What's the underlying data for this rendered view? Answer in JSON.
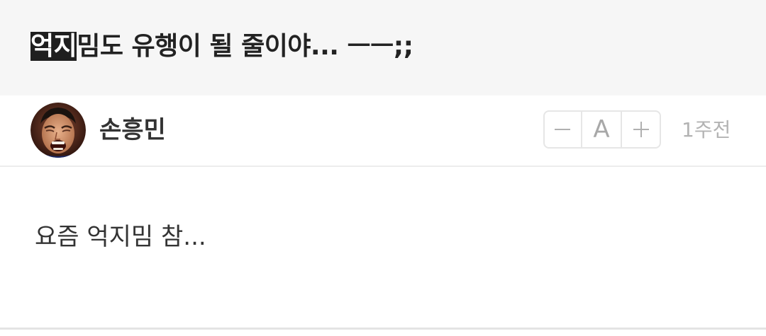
{
  "post": {
    "title_highlight": "억지",
    "title_rest": "밈도 유행이 될 줄이야... ㅡㅡ;;",
    "body": "요즘 억지밈 참..."
  },
  "author": {
    "name": "손흥민",
    "avatar_icon": "profile-photo-icon"
  },
  "meta": {
    "time": "1주전"
  },
  "font_controls": {
    "decrease_icon": "minus-icon",
    "label": "A",
    "increase_icon": "plus-icon"
  },
  "colors": {
    "title_bar_bg": "#f6f6f6",
    "highlight_bg": "#1f1f1f",
    "text": "#333333",
    "muted": "#b3b3b3"
  }
}
